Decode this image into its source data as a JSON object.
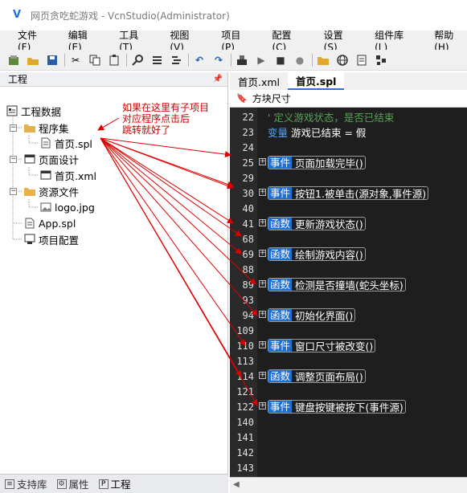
{
  "window": {
    "title": "网页贪吃蛇游戏 - VcnStudio(Administrator)"
  },
  "menu": [
    "文件(F)",
    "编辑(E)",
    "工具(T)",
    "视图(V)",
    "项目(P)",
    "配置(C)",
    "设置(S)",
    "组件库(L)",
    "帮助(H)"
  ],
  "project_panel": {
    "header": "工程",
    "pin_icon": "pin-icon",
    "tree": [
      {
        "label": "工程数据"
      },
      {
        "label": "程序集"
      },
      {
        "label": "首页.spl"
      },
      {
        "label": "页面设计"
      },
      {
        "label": "首页.xml"
      },
      {
        "label": "资源文件"
      },
      {
        "label": "logo.jpg"
      },
      {
        "label": "App.spl"
      },
      {
        "label": "项目配置"
      }
    ]
  },
  "annotation": "如果在这里有子项目\n对应程序点击后\n跳转就好了",
  "bottom_tabs": [
    "支持库",
    "属性",
    "工程"
  ],
  "editor": {
    "tabs": [
      "首页.xml",
      "首页.spl"
    ],
    "breadcrumb": "方块尺寸",
    "lines": [
      {
        "n": "22",
        "type": "comment",
        "text": "' 定义游戏状态，是否已结束"
      },
      {
        "n": "23",
        "type": "var",
        "kw": "变量",
        "text": " 游戏已结束 = 假"
      },
      {
        "n": "24",
        "type": "blank"
      },
      {
        "n": "25",
        "type": "fn",
        "kw": "事件",
        "text": "页面加载完毕()"
      },
      {
        "n": "29",
        "type": "blank"
      },
      {
        "n": "30",
        "type": "fn",
        "kw": "事件",
        "text": "按钮1.被单击(源对象,事件源)"
      },
      {
        "n": "40",
        "type": "blank"
      },
      {
        "n": "41",
        "type": "fn",
        "kw": "函数",
        "text": "更新游戏状态()"
      },
      {
        "n": "68",
        "type": "blank"
      },
      {
        "n": "69",
        "type": "fn",
        "kw": "函数",
        "text": "绘制游戏内容()"
      },
      {
        "n": "88",
        "type": "blank"
      },
      {
        "n": "89",
        "type": "fn",
        "kw": "函数",
        "text": "检测是否撞墙(蛇头坐标)"
      },
      {
        "n": "93",
        "type": "blank"
      },
      {
        "n": "94",
        "type": "fn",
        "kw": "函数",
        "text": "初始化界面()"
      },
      {
        "n": "109",
        "type": "blank"
      },
      {
        "n": "110",
        "type": "fn",
        "kw": "事件",
        "text": "窗口尺寸被改变()"
      },
      {
        "n": "113",
        "type": "blank"
      },
      {
        "n": "114",
        "type": "fn",
        "kw": "函数",
        "text": "调整页面布局()"
      },
      {
        "n": "121",
        "type": "blank"
      },
      {
        "n": "122",
        "type": "fn",
        "kw": "事件",
        "text": "键盘按键被按下(事件源)"
      },
      {
        "n": "140",
        "type": "blank"
      },
      {
        "n": "141",
        "type": "blank"
      },
      {
        "n": "142",
        "type": "blank"
      },
      {
        "n": "143",
        "type": "blank"
      }
    ]
  },
  "colors": {
    "accent": "#1f6fd0",
    "annotation": "#cc0000",
    "editor_bg": "#1e1e1e"
  }
}
